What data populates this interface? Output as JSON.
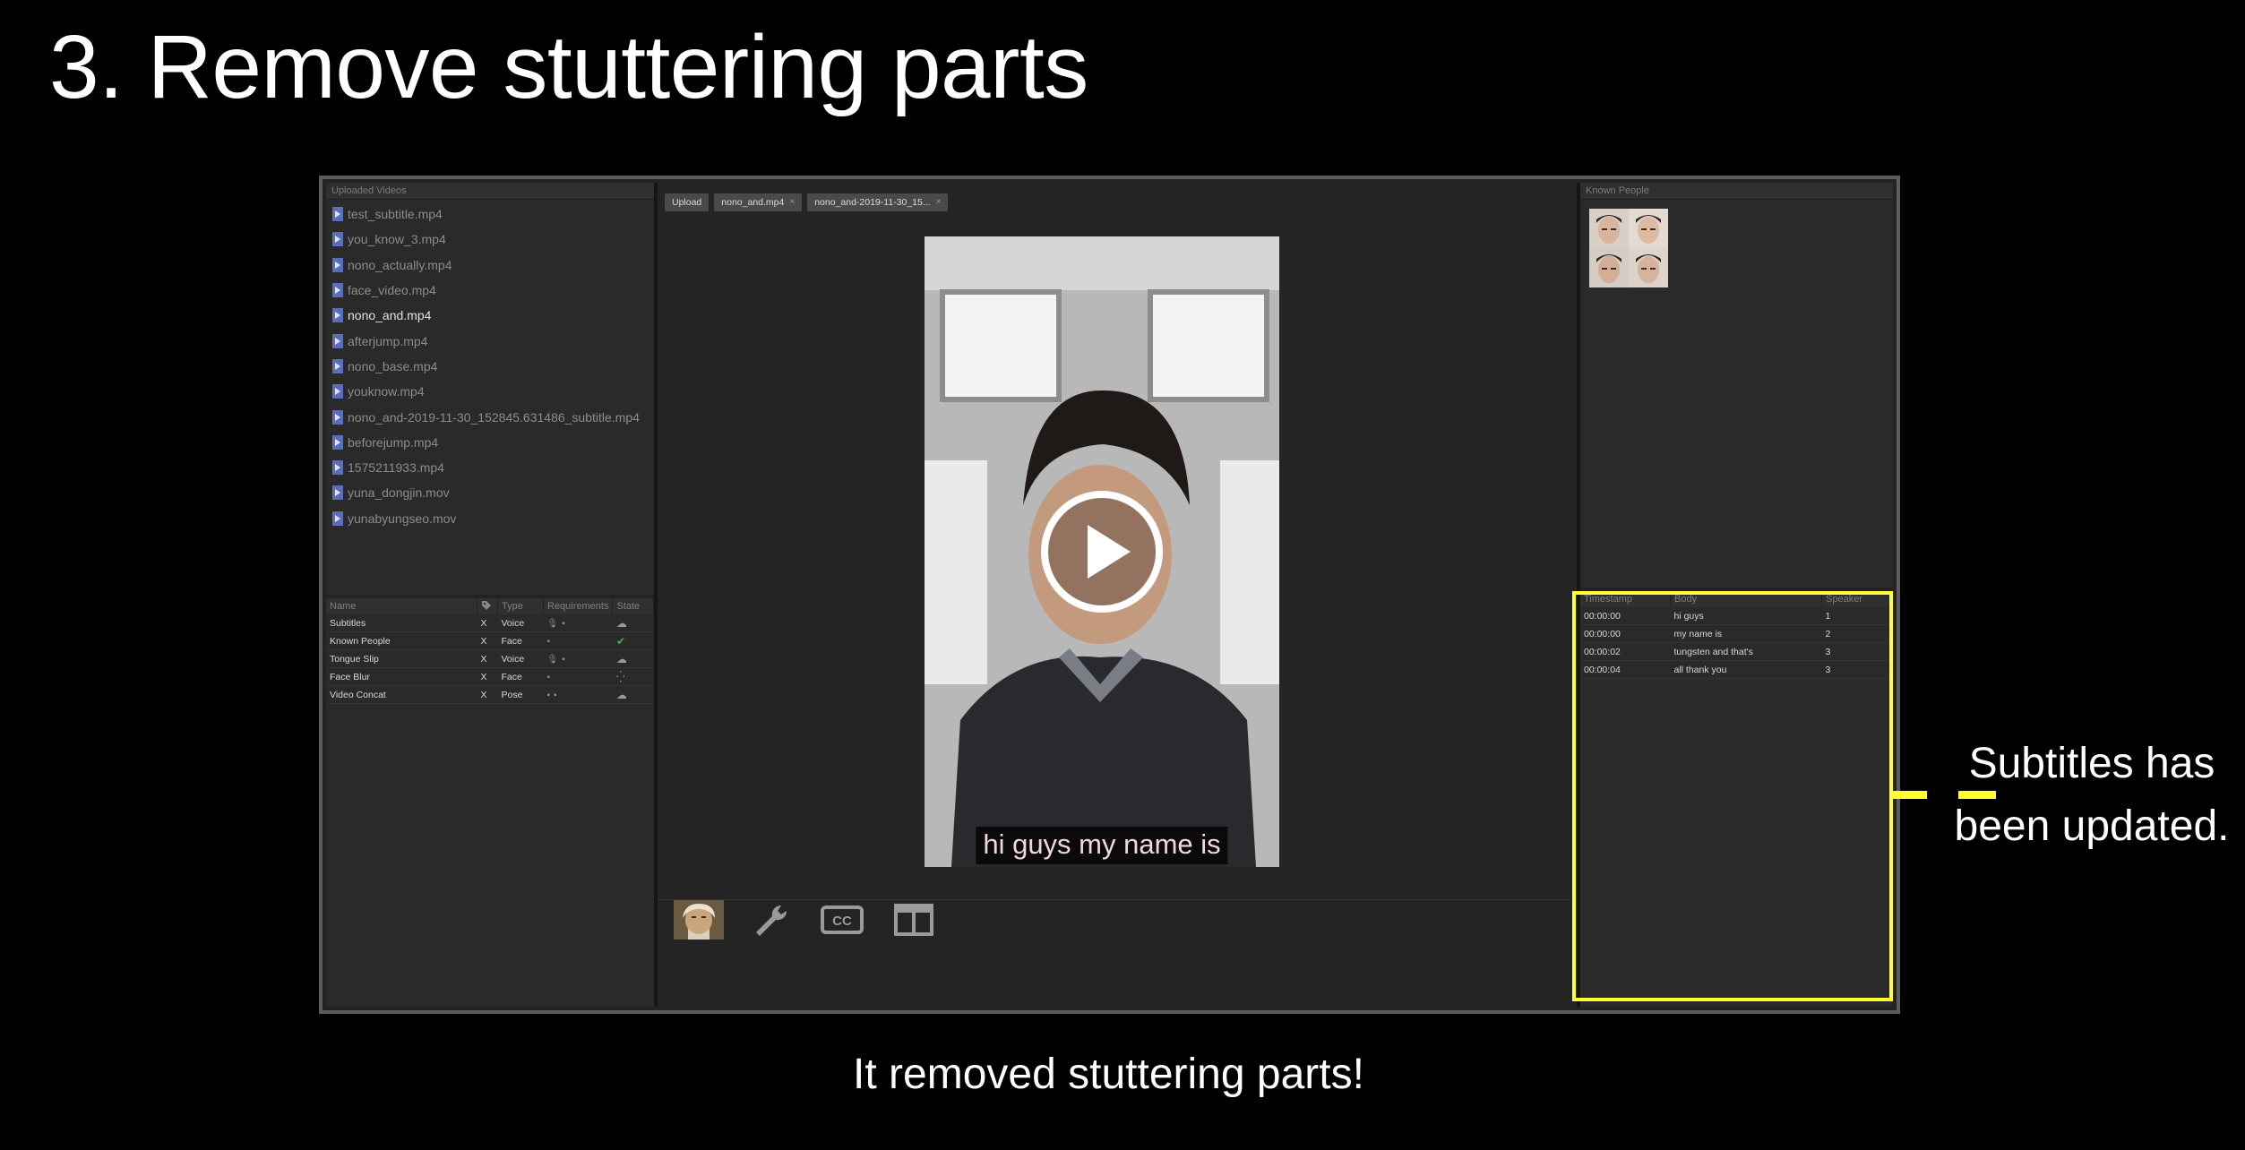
{
  "slide": {
    "title": "3. Remove stuttering parts",
    "caption": "It removed stuttering parts!",
    "callout_line1": "Subtitles has",
    "callout_line2": "been updated."
  },
  "uploaded_videos": {
    "header": "Uploaded Videos",
    "selected_index": 4,
    "items": [
      "test_subtitle.mp4",
      "you_know_3.mp4",
      "nono_actually.mp4",
      "face_video.mp4",
      "nono_and.mp4",
      "afterjump.mp4",
      "nono_base.mp4",
      "youknow.mp4",
      "nono_and-2019-11-30_152845.631486_subtitle.mp4",
      "beforejump.mp4",
      "1575211933.mp4",
      "yuna_dongjin.mov",
      "yunabyungseo.mov"
    ]
  },
  "plugins": {
    "columns": [
      "Name",
      "",
      "Type",
      "Requirements",
      "State"
    ],
    "rows": [
      {
        "name": "Subtitles",
        "x": "X",
        "type": "Voice",
        "state": "cloud"
      },
      {
        "name": "Known People",
        "x": "X",
        "type": "Face",
        "state": "check"
      },
      {
        "name": "Tongue Slip",
        "x": "X",
        "type": "Voice",
        "state": "cloud"
      },
      {
        "name": "Face Blur",
        "x": "X",
        "type": "Face",
        "state": "spinner"
      },
      {
        "name": "Video Concat",
        "x": "X",
        "type": "Pose",
        "state": "cloud"
      }
    ]
  },
  "tabs": {
    "upload": "Upload",
    "items": [
      "nono_and.mp4",
      "nono_and-2019-11-30_15..."
    ],
    "close_glyph": "×"
  },
  "player": {
    "subtitle": "hi guys my name is"
  },
  "known_people": {
    "header": "Known People"
  },
  "subtitles_table": {
    "columns": [
      "Timestamp",
      "Body",
      "Speaker"
    ],
    "rows": [
      {
        "timestamp": "00:00:00",
        "body": "hi guys",
        "speaker": "1"
      },
      {
        "timestamp": "00:00:00",
        "body": "my name is",
        "speaker": "2"
      },
      {
        "timestamp": "00:00:02",
        "body": "tungsten and that's",
        "speaker": "3"
      },
      {
        "timestamp": "00:00:04",
        "body": "all thank you",
        "speaker": "3"
      }
    ]
  },
  "colors": {
    "highlight": "#ffff33",
    "background": "#000000",
    "panel": "#2a2a2a"
  },
  "toolbar_icons": [
    "portrait-thumbnail-icon",
    "wrench-icon",
    "closed-captions-icon",
    "split-view-icon"
  ]
}
